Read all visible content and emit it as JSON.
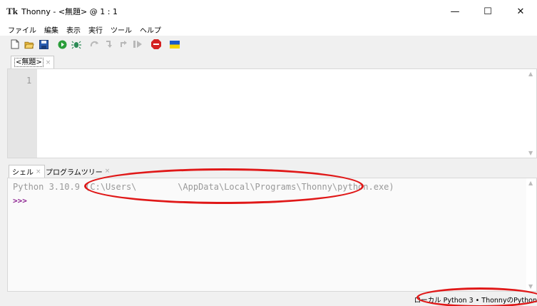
{
  "window": {
    "title": "Thonny  -  <無題>  @  1 : 1",
    "logo": "Tk",
    "minimize": "—",
    "maximize": "☐",
    "close": "✕"
  },
  "menu": [
    "ファイル",
    "編集",
    "表示",
    "実行",
    "ツール",
    "ヘルプ"
  ],
  "toolbar": {
    "icons": [
      "new-file-icon",
      "open-folder-icon",
      "save-icon",
      "run-icon",
      "debug-icon",
      "step-over-icon",
      "step-into-icon",
      "step-out-icon",
      "resume-icon",
      "stop-icon",
      "ukraine-flag-icon"
    ],
    "colors": {
      "run": "#2a9d3a",
      "stop": "#d42020",
      "flag_blue": "#1a5ac8",
      "flag_yellow": "#f5d400"
    }
  },
  "editor": {
    "tab_label": "<無題>",
    "tab_close": "×",
    "line_number": "1"
  },
  "shell_tabs": [
    {
      "label": "シェル",
      "close": "×"
    },
    {
      "label": "プログラムツリー",
      "close": "×"
    }
  ],
  "shell": {
    "banner": "Python 3.10.9 (C:\\Users\\        \\AppData\\Local\\Programs\\Thonny\\python.exe)",
    "prompt": ">>>"
  },
  "status": {
    "interpreter": "ローカル Python 3  •  ThonnyのPython"
  },
  "annotation_color": "#e01818"
}
